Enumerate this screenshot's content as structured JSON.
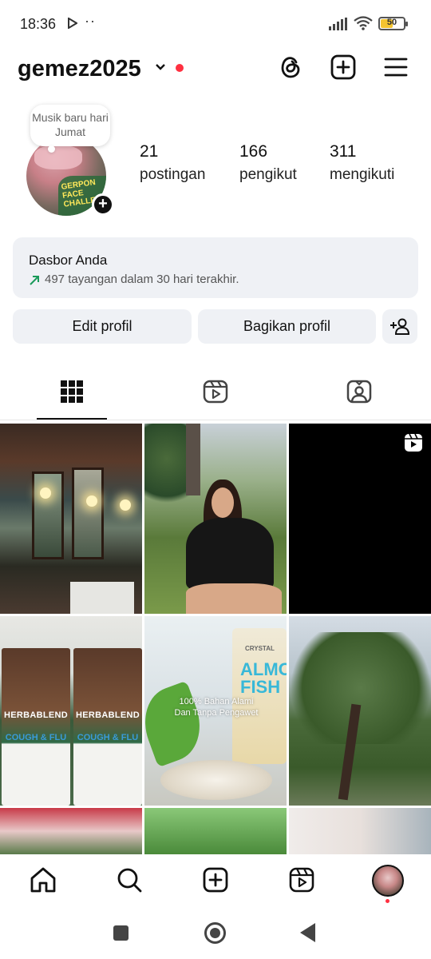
{
  "status_bar": {
    "time": "18:36",
    "extra_dots": "··",
    "battery_level": "50",
    "icons": [
      "play-icon",
      "signal-icon",
      "wifi-icon",
      "battery-icon"
    ]
  },
  "header": {
    "username": "gemez2025",
    "icons": [
      "chevron-down-icon",
      "threads-icon",
      "add-post-icon",
      "menu-icon"
    ],
    "notification_dot_color": "#ff3040"
  },
  "profile": {
    "note": "Musik baru hari Jumat",
    "avatar_text": "GERPON FACE CHALLENG",
    "stats": [
      {
        "count": "21",
        "label": "postingan"
      },
      {
        "count": "166",
        "label": "pengikut"
      },
      {
        "count": "311",
        "label": "mengikuti"
      }
    ]
  },
  "dashboard": {
    "title": "Dasbor Anda",
    "subtitle": "497 tayangan dalam 30 hari terakhir."
  },
  "actions": {
    "edit_profile": "Edit profil",
    "share_profile": "Bagikan profil"
  },
  "tabs": [
    {
      "name": "grid-icon",
      "active": true
    },
    {
      "name": "reels-icon",
      "active": false
    },
    {
      "name": "tagged-icon",
      "active": false
    }
  ],
  "posts": {
    "box_brand": "HERBABLEND",
    "box_product": "COUGH & FLU",
    "caption_line1": "100% Bahan Alami",
    "caption_line2": "Dan Tanpa Pengawet",
    "pack_text": "ALMO FISH",
    "pack_brand": "CRYSTAL"
  },
  "bottom_nav": [
    "home-icon",
    "search-icon",
    "create-icon",
    "reels-icon",
    "profile-avatar"
  ],
  "system_nav": [
    "recent-apps-button",
    "home-button",
    "back-button"
  ]
}
